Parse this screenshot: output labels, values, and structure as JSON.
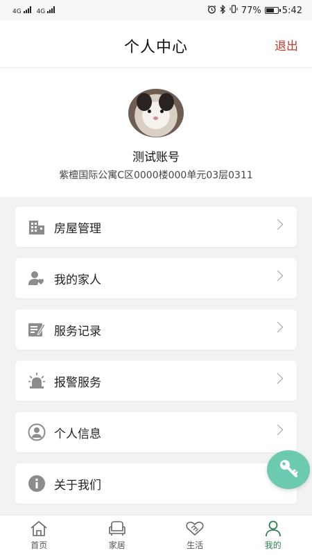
{
  "status_bar": {
    "sim1": "4G",
    "sim2": "4G",
    "battery": "77%",
    "battery_level": 0.77,
    "time": "5:42"
  },
  "header": {
    "title": "个人中心",
    "logout_label": "退出"
  },
  "profile": {
    "username": "测试账号",
    "address": "紫檀国际公寓C区0000楼000单元03层0311"
  },
  "menu": [
    {
      "label": "房屋管理",
      "icon": "building-icon"
    },
    {
      "label": "我的家人",
      "icon": "family-icon"
    },
    {
      "label": "服务记录",
      "icon": "record-icon"
    },
    {
      "label": "报警服务",
      "icon": "alarm-icon"
    },
    {
      "label": "个人信息",
      "icon": "user-circle-icon"
    },
    {
      "label": "关于我们",
      "icon": "info-icon"
    }
  ],
  "fab": {
    "icon": "key-icon"
  },
  "bottom_nav": [
    {
      "label": "首页",
      "icon": "home-icon"
    },
    {
      "label": "家居",
      "icon": "sofa-icon"
    },
    {
      "label": "生活",
      "icon": "handshake-icon"
    },
    {
      "label": "我的",
      "icon": "person-icon",
      "active": true
    }
  ],
  "colors": {
    "accent": "#2e7d4f",
    "logout": "#c0392b",
    "fab": "#6ccab0",
    "icon_gray": "#8c8c8c"
  }
}
